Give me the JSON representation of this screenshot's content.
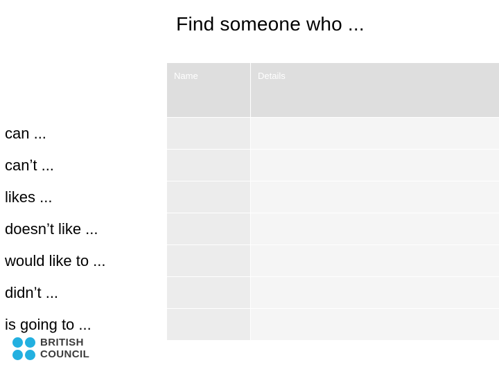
{
  "slide": {
    "title": "Find someone who ...",
    "table": {
      "columns": [
        {
          "key": "prompt",
          "label": ""
        },
        {
          "key": "name",
          "label": "Name"
        },
        {
          "key": "details",
          "label": "Details"
        }
      ],
      "rows": [
        {
          "prompt": "can ...",
          "name": "",
          "details": ""
        },
        {
          "prompt": "can’t ...",
          "name": "",
          "details": ""
        },
        {
          "prompt": "likes ...",
          "name": "",
          "details": ""
        },
        {
          "prompt": "doesn’t like ...",
          "name": "",
          "details": ""
        },
        {
          "prompt": "would like to ...",
          "name": "",
          "details": ""
        },
        {
          "prompt": "didn’t ...",
          "name": "",
          "details": ""
        },
        {
          "prompt": "is going to ...",
          "name": "",
          "details": ""
        }
      ]
    },
    "logo": {
      "line1": "BRITISH",
      "line2": "COUNCIL",
      "dot_color": "#23b0e0"
    }
  }
}
